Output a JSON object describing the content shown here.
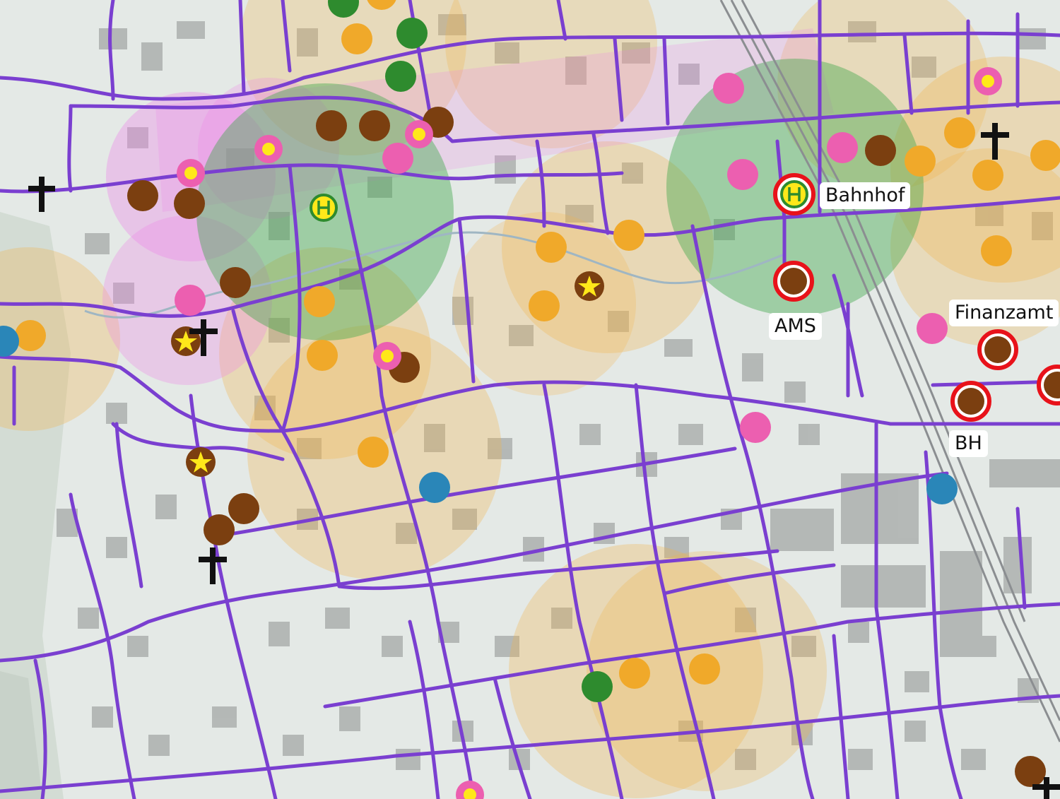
{
  "map": {
    "labels": {
      "bahnhof": "Bahnhof",
      "ams": "AMS",
      "finanzamt": "Finanzamt",
      "bh": "BH"
    },
    "colors": {
      "road": "#7a3fd0",
      "poi_orange": "#f0a92a",
      "poi_brown": "#7b3f10",
      "poi_green": "#2e8b2e",
      "poi_pink": "#ec5fb0",
      "poi_blue": "#2a86b8",
      "poi_highlight_ring": "#e8121a",
      "zone_green": "#3fa84a",
      "zone_orange": "#f2b24a",
      "zone_pink": "#ee80e8",
      "building": "#a9adab",
      "background": "#e4e9e6"
    },
    "icons": [
      "bus-stop-icon",
      "star-icon",
      "church-cross-icon",
      "railway-track"
    ]
  }
}
